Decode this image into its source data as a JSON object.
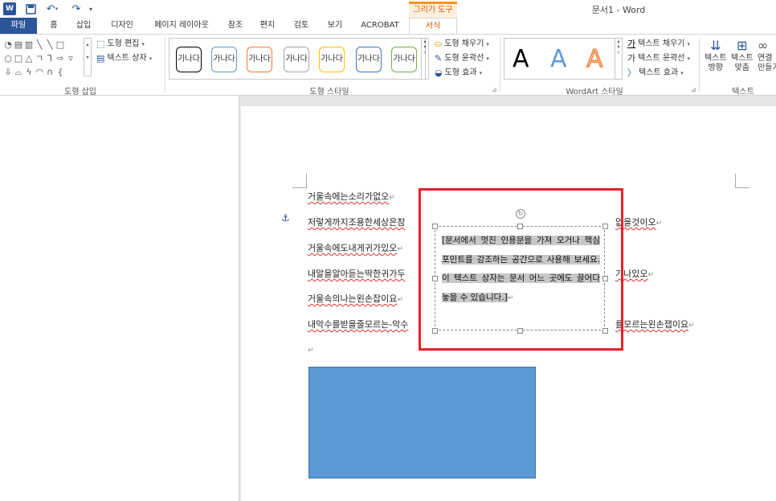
{
  "titlebar": {
    "app_icon": "W",
    "save_icon": "save-icon",
    "undo_icon": "undo-icon",
    "redo_icon": "redo-icon",
    "contextual_tool": "그리기 도구",
    "doc_title": "문서1 - Word"
  },
  "tabs": [
    {
      "label": "파일"
    },
    {
      "label": "홈"
    },
    {
      "label": "삽입"
    },
    {
      "label": "디자인"
    },
    {
      "label": "페이지 레이아웃"
    },
    {
      "label": "참조"
    },
    {
      "label": "편지"
    },
    {
      "label": "검토"
    },
    {
      "label": "보기"
    },
    {
      "label": "ACROBAT"
    },
    {
      "label": "서식"
    }
  ],
  "ribbon": {
    "insert_shapes": {
      "label": "도형 삽입",
      "edit_shape": "도형 편집",
      "text_box": "텍스트 상자"
    },
    "shape_styles": {
      "label": "도형 스타일",
      "thumb_text": "가나다",
      "thumb_colors": [
        "#000000",
        "#5b9bd5",
        "#ed7d31",
        "#a5a5a5",
        "#ffc000",
        "#4472c4",
        "#70ad47"
      ],
      "fill": "도형 채우기",
      "outline": "도형 윤곽선",
      "effects": "도형 효과"
    },
    "wordart_styles": {
      "label": "WordArt 스타일",
      "letter": "A",
      "text_fill": "텍스트 채우기",
      "text_outline": "텍스트 윤곽선",
      "text_effects": "텍스트 효과"
    },
    "text": {
      "label": "텍스트",
      "direction": "텍스트 방향",
      "align": "텍스트 맞춤",
      "link": "연결 만들기",
      "direction_line1": "텍스트",
      "direction_line2": "방향",
      "align_line1": "텍스트",
      "align_line2": "맞춤",
      "link_line1": "연결",
      "link_line2": "만들기"
    }
  },
  "document": {
    "lines": [
      {
        "left": "거울속에는소리가없오",
        "right": ""
      },
      {
        "left": "저렇게까지조용한세상은참",
        "right": "없을것이오"
      },
      {
        "left": "거울속에도내게귀가있오",
        "right": ""
      },
      {
        "left": "내말을알아듣는딱한귀가두",
        "right": "가나있오"
      },
      {
        "left": "거울속의나는왼손잡이요",
        "right": ""
      },
      {
        "left": "내악수를받을줄모르는-악수",
        "right": "를모르는왼손잽이요"
      }
    ],
    "textbox_text": "[문서에서 멋진 인용문을 가져 오거나 핵심 포인트를 강조하는 공간으로 사용해 보세요. 이 텍스트 상자는 문서 어느 곳에도 끌어다 놓을 수 있습니다.]",
    "para_mark": "↵"
  },
  "colors": {
    "word_blue": "#2b579a",
    "context_orange": "#d35400",
    "highlight_red": "#e8202a",
    "shape_blue": "#5b9bd5"
  }
}
